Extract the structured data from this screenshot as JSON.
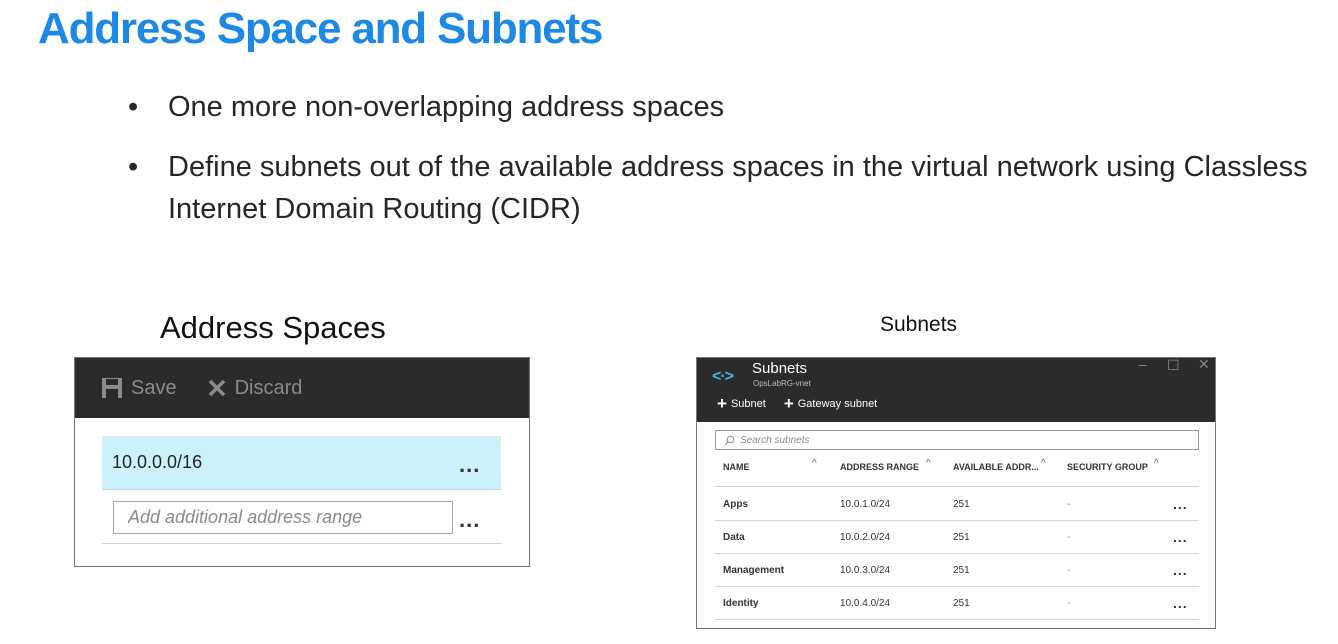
{
  "slide": {
    "title": "Address Space and Subnets",
    "bullets": [
      "One more non-overlapping address spaces",
      "Define subnets out of the available address spaces in the virtual network using Classless Internet Domain Routing (CIDR)"
    ],
    "bullet_glyph": "•"
  },
  "address_panel": {
    "caption": "Address Spaces",
    "toolbar": {
      "save_label": "Save",
      "discard_label": "Discard"
    },
    "ranges": [
      "10.0.0.0/16"
    ],
    "input_placeholder": "Add additional address range",
    "ellipsis": "..."
  },
  "subnets_panel": {
    "caption": "Subnets",
    "title": "Subnets",
    "subtitle": "OpsLabRG-vnet",
    "logo_glyph": "<·>",
    "window_controls": {
      "minimize": "–",
      "maximize": "☐",
      "close": "✕"
    },
    "actions": {
      "add_subnet": "Subnet",
      "add_gateway": "Gateway subnet",
      "plus": "+"
    },
    "search_placeholder": "Search subnets",
    "columns": [
      "NAME",
      "ADDRESS RANGE",
      "AVAILABLE ADDR...",
      "SECURITY GROUP"
    ],
    "sort_glyph": "^",
    "rows": [
      {
        "name": "Apps",
        "range": "10.0.1.0/24",
        "available": "251",
        "security": "-",
        "more": "..."
      },
      {
        "name": "Data",
        "range": "10.0.2.0/24",
        "available": "251",
        "security": "-",
        "more": "..."
      },
      {
        "name": "Management",
        "range": "10.0.3.0/24",
        "available": "251",
        "security": "-",
        "more": "..."
      },
      {
        "name": "Identity",
        "range": "10.0.4.0/24",
        "available": "251",
        "security": "-",
        "more": "..."
      }
    ]
  },
  "colors": {
    "title": "#1e88e5",
    "toolbar": "#2a2b2c",
    "selected_row": "#ccf1fb",
    "logo": "#49b6e8"
  }
}
